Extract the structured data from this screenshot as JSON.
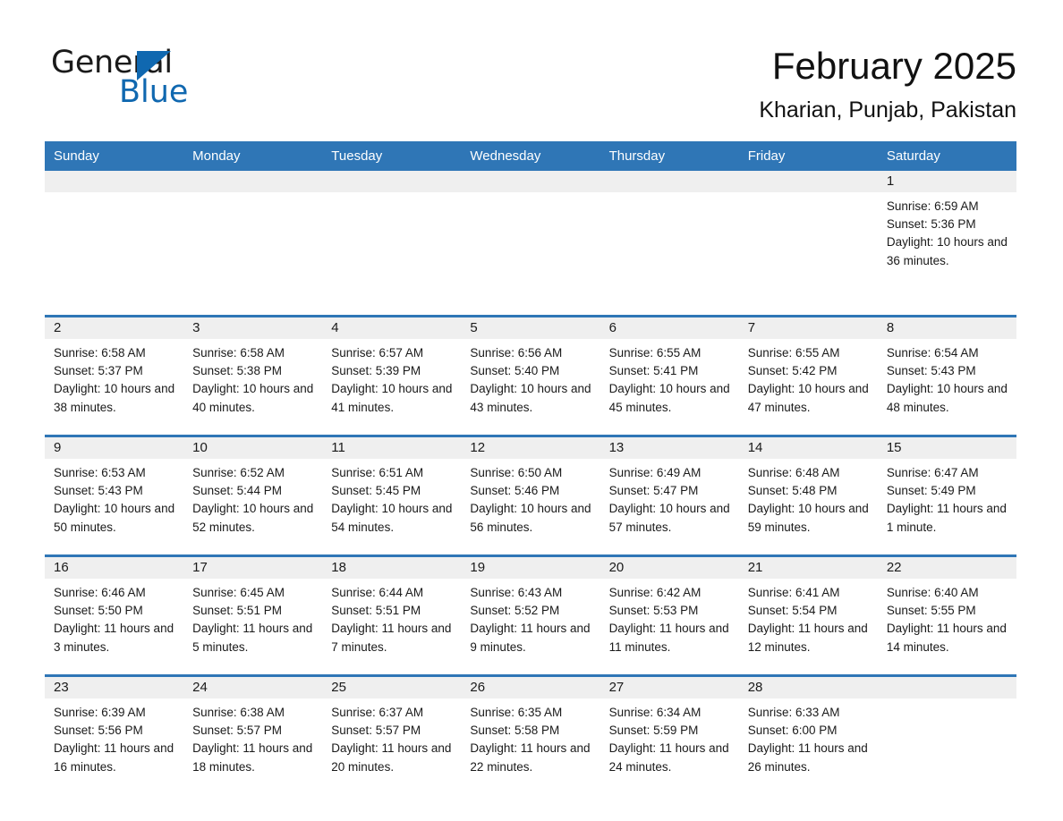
{
  "brand": {
    "name_part1": "General",
    "name_part2": "Blue",
    "accent_color": "#1068b0"
  },
  "header": {
    "title": "February 2025",
    "subtitle": "Kharian, Punjab, Pakistan"
  },
  "theme": {
    "header_blue": "#2f76b6",
    "day_band_gray": "#efefef"
  },
  "weekday_headers": [
    "Sunday",
    "Monday",
    "Tuesday",
    "Wednesday",
    "Thursday",
    "Friday",
    "Saturday"
  ],
  "weeks": [
    [
      {
        "day": "",
        "sunrise": "",
        "sunset": "",
        "daylight": ""
      },
      {
        "day": "",
        "sunrise": "",
        "sunset": "",
        "daylight": ""
      },
      {
        "day": "",
        "sunrise": "",
        "sunset": "",
        "daylight": ""
      },
      {
        "day": "",
        "sunrise": "",
        "sunset": "",
        "daylight": ""
      },
      {
        "day": "",
        "sunrise": "",
        "sunset": "",
        "daylight": ""
      },
      {
        "day": "",
        "sunrise": "",
        "sunset": "",
        "daylight": ""
      },
      {
        "day": "1",
        "sunrise": "Sunrise: 6:59 AM",
        "sunset": "Sunset: 5:36 PM",
        "daylight": "Daylight: 10 hours and 36 minutes."
      }
    ],
    [
      {
        "day": "2",
        "sunrise": "Sunrise: 6:58 AM",
        "sunset": "Sunset: 5:37 PM",
        "daylight": "Daylight: 10 hours and 38 minutes."
      },
      {
        "day": "3",
        "sunrise": "Sunrise: 6:58 AM",
        "sunset": "Sunset: 5:38 PM",
        "daylight": "Daylight: 10 hours and 40 minutes."
      },
      {
        "day": "4",
        "sunrise": "Sunrise: 6:57 AM",
        "sunset": "Sunset: 5:39 PM",
        "daylight": "Daylight: 10 hours and 41 minutes."
      },
      {
        "day": "5",
        "sunrise": "Sunrise: 6:56 AM",
        "sunset": "Sunset: 5:40 PM",
        "daylight": "Daylight: 10 hours and 43 minutes."
      },
      {
        "day": "6",
        "sunrise": "Sunrise: 6:55 AM",
        "sunset": "Sunset: 5:41 PM",
        "daylight": "Daylight: 10 hours and 45 minutes."
      },
      {
        "day": "7",
        "sunrise": "Sunrise: 6:55 AM",
        "sunset": "Sunset: 5:42 PM",
        "daylight": "Daylight: 10 hours and 47 minutes."
      },
      {
        "day": "8",
        "sunrise": "Sunrise: 6:54 AM",
        "sunset": "Sunset: 5:43 PM",
        "daylight": "Daylight: 10 hours and 48 minutes."
      }
    ],
    [
      {
        "day": "9",
        "sunrise": "Sunrise: 6:53 AM",
        "sunset": "Sunset: 5:43 PM",
        "daylight": "Daylight: 10 hours and 50 minutes."
      },
      {
        "day": "10",
        "sunrise": "Sunrise: 6:52 AM",
        "sunset": "Sunset: 5:44 PM",
        "daylight": "Daylight: 10 hours and 52 minutes."
      },
      {
        "day": "11",
        "sunrise": "Sunrise: 6:51 AM",
        "sunset": "Sunset: 5:45 PM",
        "daylight": "Daylight: 10 hours and 54 minutes."
      },
      {
        "day": "12",
        "sunrise": "Sunrise: 6:50 AM",
        "sunset": "Sunset: 5:46 PM",
        "daylight": "Daylight: 10 hours and 56 minutes."
      },
      {
        "day": "13",
        "sunrise": "Sunrise: 6:49 AM",
        "sunset": "Sunset: 5:47 PM",
        "daylight": "Daylight: 10 hours and 57 minutes."
      },
      {
        "day": "14",
        "sunrise": "Sunrise: 6:48 AM",
        "sunset": "Sunset: 5:48 PM",
        "daylight": "Daylight: 10 hours and 59 minutes."
      },
      {
        "day": "15",
        "sunrise": "Sunrise: 6:47 AM",
        "sunset": "Sunset: 5:49 PM",
        "daylight": "Daylight: 11 hours and 1 minute."
      }
    ],
    [
      {
        "day": "16",
        "sunrise": "Sunrise: 6:46 AM",
        "sunset": "Sunset: 5:50 PM",
        "daylight": "Daylight: 11 hours and 3 minutes."
      },
      {
        "day": "17",
        "sunrise": "Sunrise: 6:45 AM",
        "sunset": "Sunset: 5:51 PM",
        "daylight": "Daylight: 11 hours and 5 minutes."
      },
      {
        "day": "18",
        "sunrise": "Sunrise: 6:44 AM",
        "sunset": "Sunset: 5:51 PM",
        "daylight": "Daylight: 11 hours and 7 minutes."
      },
      {
        "day": "19",
        "sunrise": "Sunrise: 6:43 AM",
        "sunset": "Sunset: 5:52 PM",
        "daylight": "Daylight: 11 hours and 9 minutes."
      },
      {
        "day": "20",
        "sunrise": "Sunrise: 6:42 AM",
        "sunset": "Sunset: 5:53 PM",
        "daylight": "Daylight: 11 hours and 11 minutes."
      },
      {
        "day": "21",
        "sunrise": "Sunrise: 6:41 AM",
        "sunset": "Sunset: 5:54 PM",
        "daylight": "Daylight: 11 hours and 12 minutes."
      },
      {
        "day": "22",
        "sunrise": "Sunrise: 6:40 AM",
        "sunset": "Sunset: 5:55 PM",
        "daylight": "Daylight: 11 hours and 14 minutes."
      }
    ],
    [
      {
        "day": "23",
        "sunrise": "Sunrise: 6:39 AM",
        "sunset": "Sunset: 5:56 PM",
        "daylight": "Daylight: 11 hours and 16 minutes."
      },
      {
        "day": "24",
        "sunrise": "Sunrise: 6:38 AM",
        "sunset": "Sunset: 5:57 PM",
        "daylight": "Daylight: 11 hours and 18 minutes."
      },
      {
        "day": "25",
        "sunrise": "Sunrise: 6:37 AM",
        "sunset": "Sunset: 5:57 PM",
        "daylight": "Daylight: 11 hours and 20 minutes."
      },
      {
        "day": "26",
        "sunrise": "Sunrise: 6:35 AM",
        "sunset": "Sunset: 5:58 PM",
        "daylight": "Daylight: 11 hours and 22 minutes."
      },
      {
        "day": "27",
        "sunrise": "Sunrise: 6:34 AM",
        "sunset": "Sunset: 5:59 PM",
        "daylight": "Daylight: 11 hours and 24 minutes."
      },
      {
        "day": "28",
        "sunrise": "Sunrise: 6:33 AM",
        "sunset": "Sunset: 6:00 PM",
        "daylight": "Daylight: 11 hours and 26 minutes."
      },
      {
        "day": "",
        "sunrise": "",
        "sunset": "",
        "daylight": ""
      }
    ]
  ]
}
